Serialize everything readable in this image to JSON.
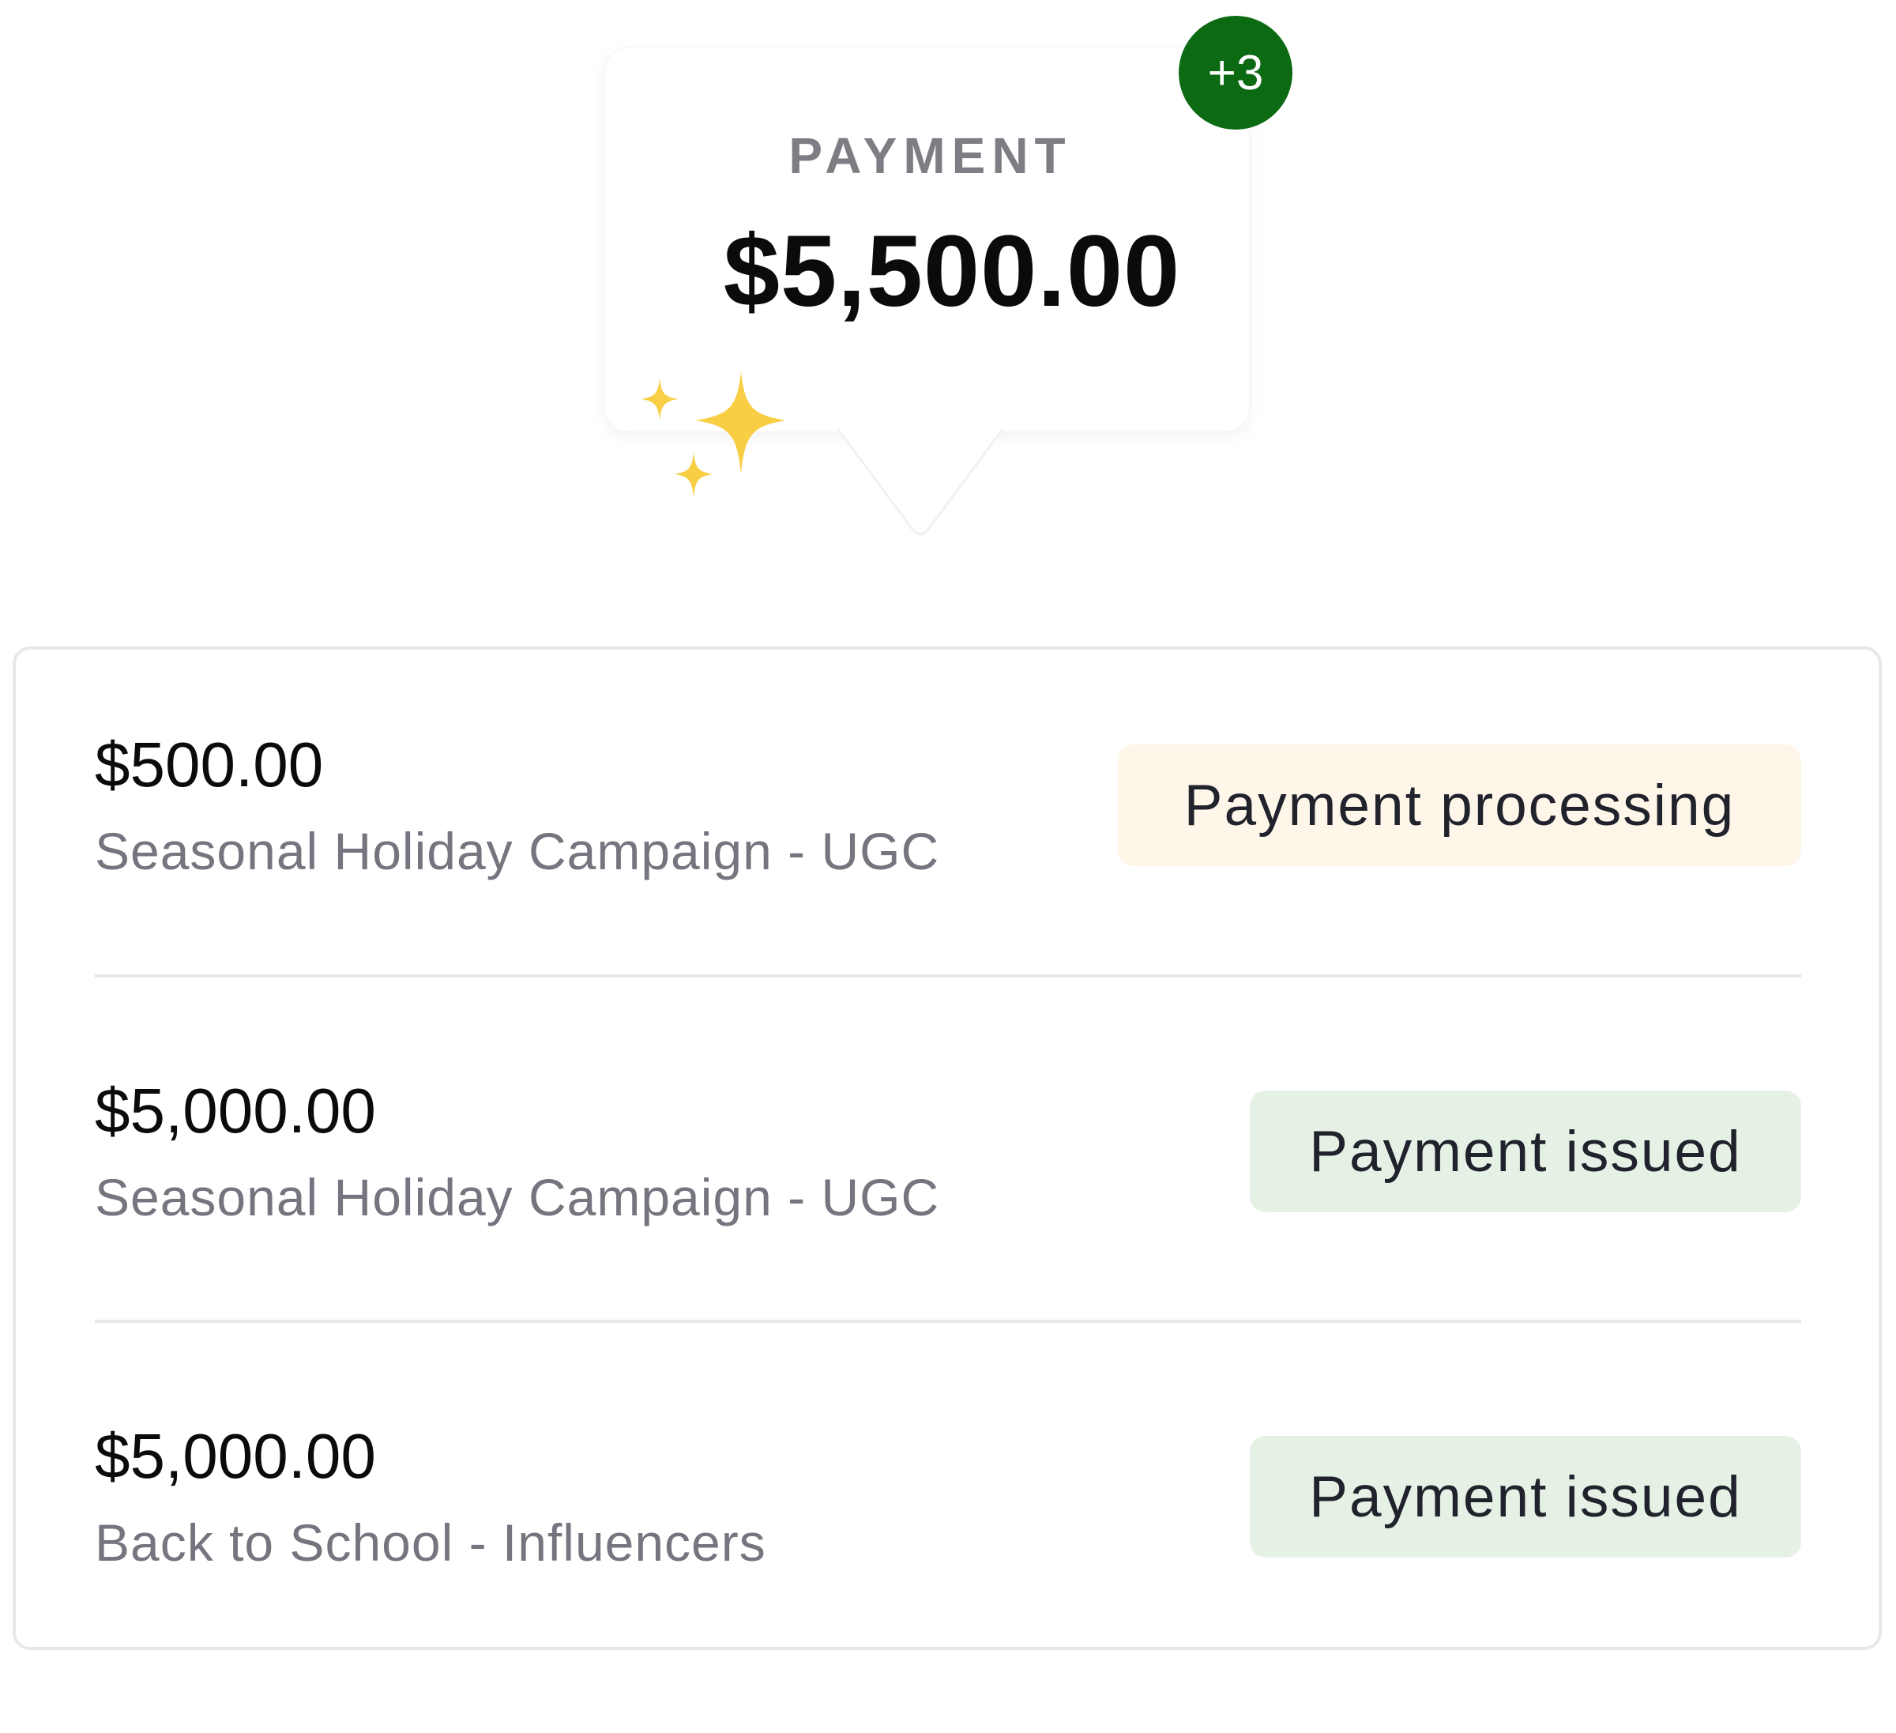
{
  "summary": {
    "label": "PAYMENT",
    "amount": "$5,500.00",
    "new_count_badge": "+3",
    "decoration_icon": "sparkles-icon",
    "badge_color": "#0b6a12"
  },
  "payments": [
    {
      "amount": "$500.00",
      "campaign": "Seasonal Holiday Campaign - UGC",
      "status": "Payment processing",
      "status_color": "#fff6ea"
    },
    {
      "amount": "$5,000.00",
      "campaign": "Seasonal Holiday Campaign - UGC",
      "status": "Payment issued",
      "status_color": "#e6f1e6"
    },
    {
      "amount": "$5,000.00",
      "campaign": "Back to School - Influencers",
      "status": "Payment issued",
      "status_color": "#e6f1e6"
    }
  ]
}
